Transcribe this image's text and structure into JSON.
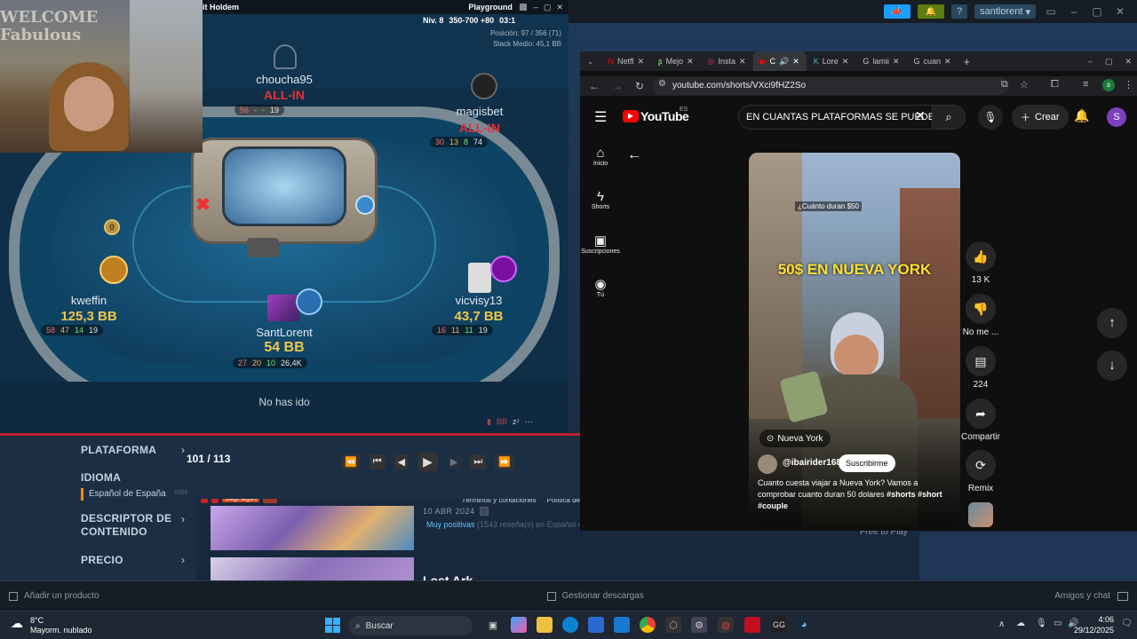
{
  "steam": {
    "topbar": {
      "user": "santlorent",
      "help": "?"
    },
    "sidebar": {
      "items": [
        {
          "label": "PLATAFORMA"
        },
        {
          "label": "IDIOMA"
        },
        {
          "label": "DESCRIPTOR DE CONTENIDO"
        },
        {
          "label": "PRECIO"
        }
      ],
      "language_value": "Español de España",
      "count": "1056"
    },
    "list": {
      "counter": "101 / 113",
      "footer_links": [
        "Términos y condiciones",
        "Política de"
      ],
      "badge": "Juego seguro",
      "date": "10 ABR 2024",
      "review_label": "Muy positivas",
      "review_detail": "(1543 reseña(s) en Español o",
      "game2_title": "Lost Ark",
      "free_label": "Free to Play"
    },
    "status": {
      "add_product": "Añadir un producto",
      "downloads": "Gestionar descargas",
      "friends": "Amigos y chat"
    }
  },
  "poker": {
    "title_left": "it Holdem",
    "title_right": "Playground",
    "level": "Niv. 8",
    "blinds": "350-700 +80",
    "timer": "03:1",
    "position": "Posición: 97 / 356 (71)",
    "stack_medio": "Stack Medio: 45,1 BB",
    "players": [
      {
        "name": "choucha95",
        "status": "ALL-IN",
        "s1": "56",
        "s2": "-",
        "s3": "-",
        "s4": "19"
      },
      {
        "name": "magisbet",
        "status": "ALL-IN",
        "s1": "30",
        "s2": "13",
        "s3": "8",
        "s4": "74"
      },
      {
        "name": "kweffin",
        "stack": "125,3 BB",
        "s1": "58",
        "s2": "47",
        "s3": "14",
        "s4": "19"
      },
      {
        "name": "vicvisy13",
        "stack": "43,7 BB",
        "s1": "16",
        "s2": "11",
        "s3": "11",
        "s4": "19"
      },
      {
        "name": "SantLorent",
        "stack": "54 BB",
        "s1": "27",
        "s2": "20",
        "s3": "10",
        "s4": "26,4K"
      }
    ],
    "not_gone": "No has ido",
    "webcam_sign": "WELCOME Fabulous"
  },
  "chrome": {
    "tabs": [
      "Netfl",
      "Mejo",
      "Insta",
      "C",
      "Lore",
      "lamii",
      "cuan"
    ],
    "url": "youtube.com/shorts/VXci9fHZ2So"
  },
  "youtube": {
    "logo": "YouTube",
    "region": "ES",
    "search_value": "EN CUANTAS PLATAFORMAS SE PUEDE",
    "create_label": "Crear",
    "avatar_letter": "S",
    "rail": [
      {
        "label": "Inicio",
        "icon": "home-icon"
      },
      {
        "label": "Shorts",
        "icon": "shorts-icon"
      },
      {
        "label": "Suscripciones",
        "icon": "subscriptions-icon"
      },
      {
        "label": "Tú",
        "icon": "you-icon"
      }
    ],
    "short": {
      "caption_top": "¿Cuánto duran $50",
      "overlay_text": "50$ EN NUEVA YORK",
      "location": "Nueva York",
      "channel": "@ibairider168",
      "subscribe": "Suscribirme",
      "description": "Cuanto cuesta viajar a Nueva York? Vamos a comprobar cuanto duran 50 dolares ",
      "hashtags": "#shorts #short #couple"
    },
    "actions": [
      {
        "label": "13 K",
        "icon": "like-icon"
      },
      {
        "label": "No me ...",
        "icon": "dislike-icon"
      },
      {
        "label": "224",
        "icon": "comment-icon"
      },
      {
        "label": "Compartir",
        "icon": "share-icon"
      },
      {
        "label": "Remix",
        "icon": "remix-icon"
      }
    ]
  },
  "taskbar": {
    "weather_temp": "8°C",
    "weather_text": "Mayorm. nublado",
    "search": "Buscar",
    "time": "4:06",
    "date": "29/12/2025"
  }
}
